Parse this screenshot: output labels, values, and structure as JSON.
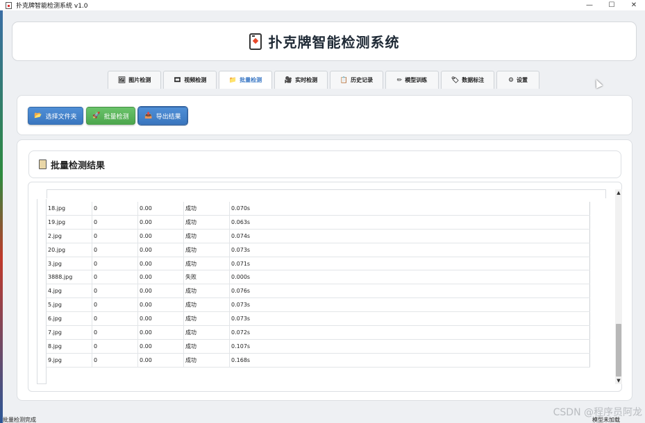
{
  "window": {
    "title": "扑克牌智能检测系统 v1.0",
    "minimize": "—",
    "maximize": "☐",
    "close": "✕"
  },
  "header": {
    "title": "扑克牌智能检测系统",
    "logo_icon": "playing-card-icon"
  },
  "tabs": [
    {
      "label": "图片检测",
      "icon": "🖼",
      "active": false
    },
    {
      "label": "视频检测",
      "icon": "🎞",
      "active": false
    },
    {
      "label": "批量检测",
      "icon": "📁",
      "active": true
    },
    {
      "label": "实时检测",
      "icon": "🎥",
      "active": false
    },
    {
      "label": "历史记录",
      "icon": "📋",
      "active": false
    },
    {
      "label": "模型训练",
      "icon": "✏",
      "active": false
    },
    {
      "label": "数据标注",
      "icon": "🏷",
      "active": false
    },
    {
      "label": "设置",
      "icon": "⚙",
      "active": false
    }
  ],
  "toolbar": {
    "select_folder": "选择文件夹",
    "batch_detect": "批量检测",
    "export_results": "导出结果"
  },
  "results": {
    "title": "批量检测结果",
    "rows": [
      [
        "18.jpg",
        "0",
        "0.00",
        "成功",
        "0.070s"
      ],
      [
        "19.jpg",
        "0",
        "0.00",
        "成功",
        "0.063s"
      ],
      [
        "2.jpg",
        "0",
        "0.00",
        "成功",
        "0.074s"
      ],
      [
        "20.jpg",
        "0",
        "0.00",
        "成功",
        "0.073s"
      ],
      [
        "3.jpg",
        "0",
        "0.00",
        "成功",
        "0.071s"
      ],
      [
        "3888.jpg",
        "0",
        "0.00",
        "失败",
        "0.000s"
      ],
      [
        "4.jpg",
        "0",
        "0.00",
        "成功",
        "0.076s"
      ],
      [
        "5.jpg",
        "0",
        "0.00",
        "成功",
        "0.073s"
      ],
      [
        "6.jpg",
        "0",
        "0.00",
        "成功",
        "0.073s"
      ],
      [
        "7.jpg",
        "0",
        "0.00",
        "成功",
        "0.072s"
      ],
      [
        "8.jpg",
        "0",
        "0.00",
        "成功",
        "0.107s"
      ],
      [
        "9.jpg",
        "0",
        "0.00",
        "成功",
        "0.168s"
      ]
    ]
  },
  "statusbar": {
    "left": "批量检测完成",
    "right": "模型未加载"
  },
  "watermark": "CSDN @程序员阿龙"
}
